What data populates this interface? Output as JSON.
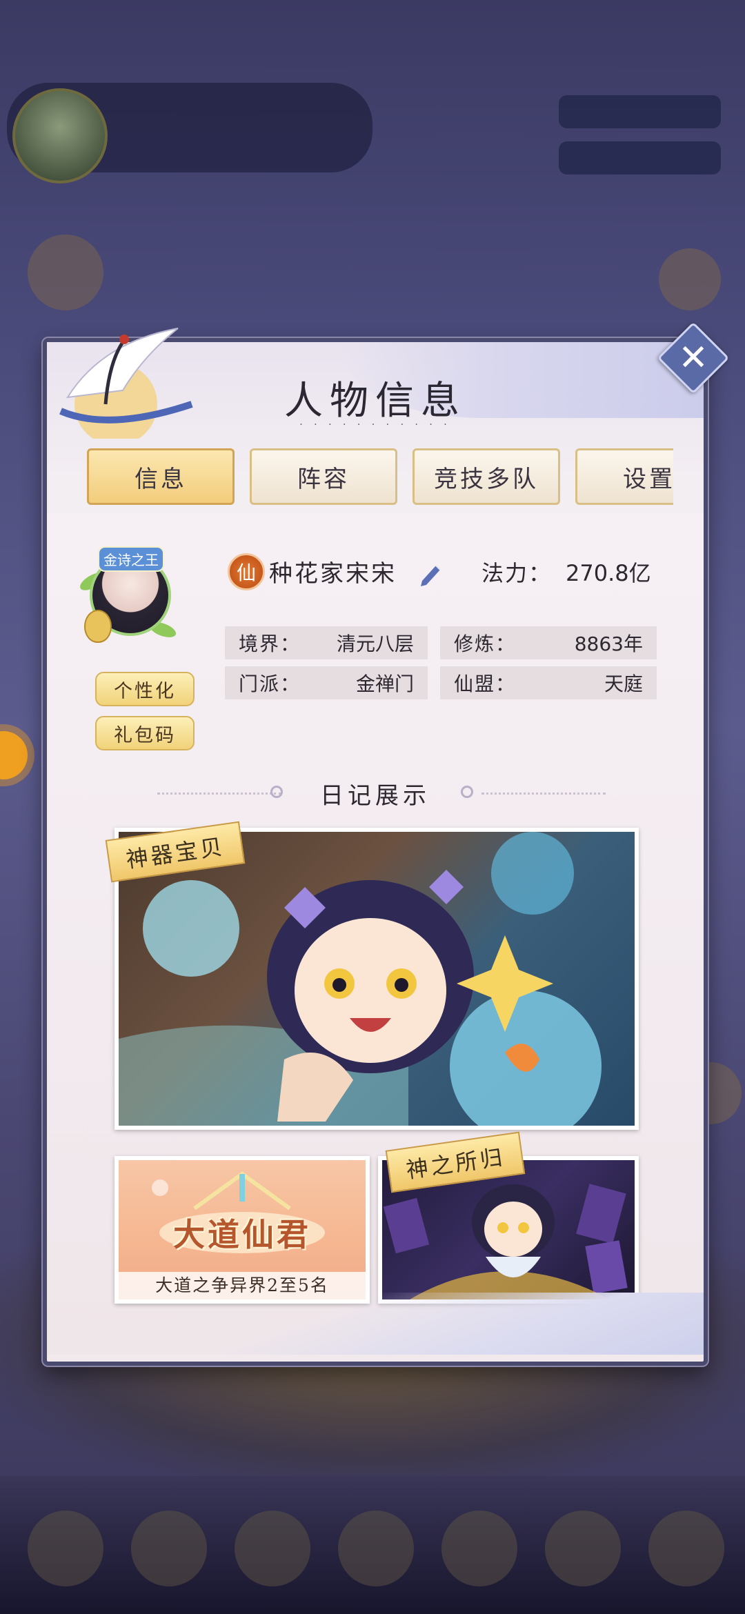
{
  "dialog": {
    "title": "人物信息",
    "close_icon": "close-icon"
  },
  "tabs": [
    {
      "label": "信息",
      "active": true
    },
    {
      "label": "阵容",
      "active": false
    },
    {
      "label": "竞技多队",
      "active": false
    },
    {
      "label": "设置",
      "active": false
    }
  ],
  "profile": {
    "avatar_badge": "金诗之王",
    "rank_glyph": "仙",
    "name": "种花家宋宋",
    "power_label": "法力：",
    "power_value": "270.8亿",
    "buttons": {
      "personalize": "个性化",
      "gift_code": "礼包码"
    },
    "stats": [
      {
        "label": "境界：",
        "value": "清元八层"
      },
      {
        "label": "修炼：",
        "value": "8863年"
      },
      {
        "label": "门派：",
        "value": "金禅门"
      },
      {
        "label": "仙盟：",
        "value": "天庭"
      }
    ]
  },
  "diary": {
    "title": "日记展示",
    "cards": [
      {
        "banner": "神器宝贝"
      },
      {
        "logo": "大道仙君",
        "caption": "大道之争异界2至5名"
      },
      {
        "banner": "神之所归"
      }
    ]
  },
  "colors": {
    "dialog_bg": "#f2e9ec",
    "tab_active": "#f3cd7c",
    "accent_orange": "#c7581c"
  }
}
